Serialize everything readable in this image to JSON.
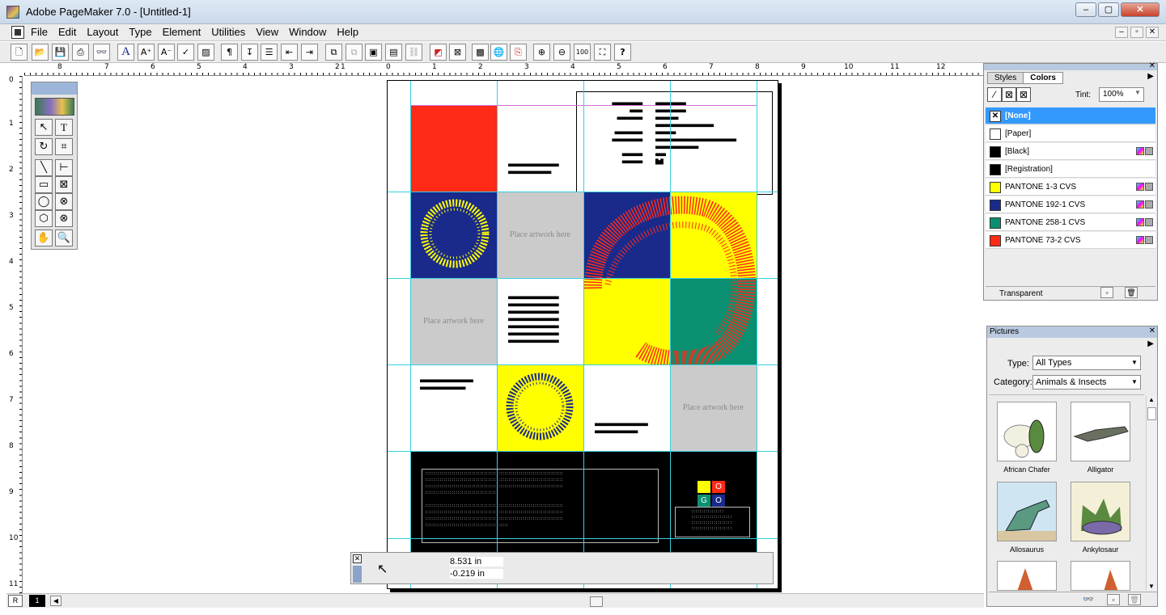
{
  "window": {
    "title": "Adobe PageMaker 7.0 - [Untitled-1]",
    "minimize": "–",
    "maximize": "▢",
    "close": "✕"
  },
  "menu": [
    "File",
    "Edit",
    "Layout",
    "Type",
    "Element",
    "Utilities",
    "View",
    "Window",
    "Help"
  ],
  "mdi_controls": [
    "–",
    "▫",
    "✕"
  ],
  "rulers": {
    "h_labels": [
      "8",
      "7",
      "6",
      "5",
      "4",
      "3",
      "2",
      "1",
      "0",
      "1",
      "2",
      "3",
      "4",
      "5",
      "6",
      "7",
      "8",
      "9",
      "10",
      "11",
      "12"
    ],
    "v_labels": [
      "0",
      "1",
      "2",
      "3",
      "4",
      "5",
      "6",
      "7",
      "8",
      "9",
      "10",
      "11"
    ]
  },
  "page": {
    "placeholder_text": "Place artwork here"
  },
  "control_palette": {
    "x": "8.531 in",
    "y": "-0.219 in"
  },
  "page_tabs": {
    "master": "R",
    "page1": "1"
  },
  "colors_panel": {
    "tabs": [
      "Styles",
      "Colors"
    ],
    "tint_label": "Tint:",
    "tint_value": "100%",
    "colors": [
      {
        "name": "[None]",
        "swatch": "none"
      },
      {
        "name": "[Paper]",
        "swatch": "#ffffff"
      },
      {
        "name": "[Black]",
        "swatch": "#000000"
      },
      {
        "name": "[Registration]",
        "swatch": "#000000"
      },
      {
        "name": "PANTONE 1-3 CVS",
        "swatch": "#ffff00"
      },
      {
        "name": "PANTONE 192-1 CVS",
        "swatch": "#1a2a8a"
      },
      {
        "name": "PANTONE 258-1 CVS",
        "swatch": "#0a9070"
      },
      {
        "name": "PANTONE 73-2 CVS",
        "swatch": "#ff2a17"
      }
    ],
    "footer": "Transparent"
  },
  "pictures_panel": {
    "title": "Pictures",
    "type_label": "Type:",
    "type_value": "All Types",
    "category_label": "Category:",
    "category_value": "Animals & Insects",
    "items": [
      "African Chafer",
      "Alligator",
      "Allosaurus",
      "Ankylosaur"
    ]
  },
  "colors": {
    "red": "#ff2a17",
    "navy": "#1a2a8a",
    "yellow": "#ffff00",
    "green": "#0a9070",
    "gray": "#cbcbcb",
    "selection": "#3399ff",
    "guide": "#37d0e0"
  }
}
